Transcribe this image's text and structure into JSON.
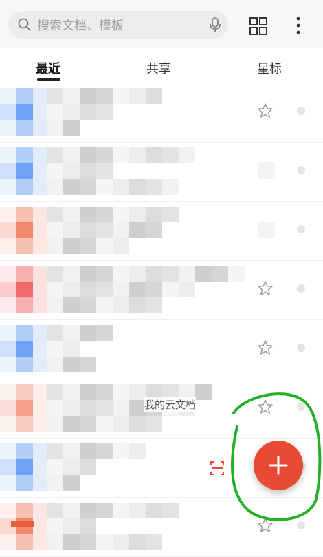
{
  "search": {
    "placeholder": "搜索文档、模板"
  },
  "icons": {
    "search": "search-icon",
    "mic": "microphone-icon",
    "grid": "grid-view-icon",
    "more": "more-vertical-icon",
    "star": "star-outline-icon",
    "plus": "plus-icon",
    "scan": "scan-icon"
  },
  "tabs": [
    {
      "label": "最近"
    },
    {
      "label": "共享"
    },
    {
      "label": "星标"
    }
  ],
  "list": {
    "overlay_label": "我的云文档",
    "rows": [
      {
        "thumb_color": "#6da3f2",
        "starred_visible": true
      },
      {
        "thumb_color": "#6da3f2",
        "starred_visible": false
      },
      {
        "thumb_color": "#f08a6e",
        "starred_visible": false
      },
      {
        "thumb_color": "#ef6a6a",
        "starred_visible": true
      },
      {
        "thumb_color": "#6da3f2",
        "starred_visible": true
      },
      {
        "thumb_color": "#f4a08a",
        "starred_visible": true
      },
      {
        "thumb_color": "#6da3f2",
        "starred_visible": false
      },
      {
        "thumb_color": "#f08a6e",
        "starred_visible": true
      }
    ]
  },
  "colors": {
    "fab": "#e84a34",
    "annotation": "#22b027",
    "blue_thumb": "#6da3f2",
    "red_thumb": "#f08a6e"
  }
}
